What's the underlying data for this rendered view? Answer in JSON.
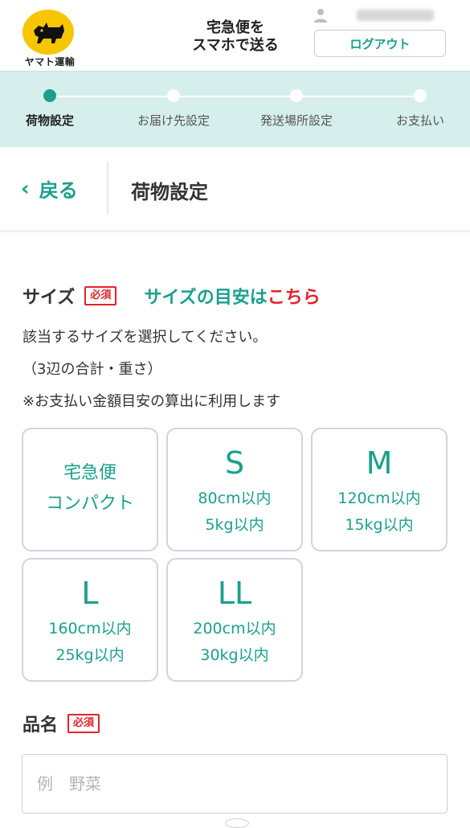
{
  "header": {
    "logo_text": "ヤマト運輸",
    "tagline_line1": "宅急便を",
    "tagline_line2": "スマホで送る",
    "logout_label": "ログアウト"
  },
  "steps": [
    {
      "label": "荷物設定",
      "active": true
    },
    {
      "label": "お届け先設定",
      "active": false
    },
    {
      "label": "発送場所設定",
      "active": false
    },
    {
      "label": "お支払い",
      "active": false
    }
  ],
  "titlebar": {
    "back_label": "戻る",
    "page_title": "荷物設定"
  },
  "size_section": {
    "label": "サイズ",
    "required_badge": "必須",
    "guide_text": "サイズの目安は",
    "guide_link": "こちら",
    "desc_line1": "該当するサイズを選択してください。",
    "desc_line2": "（3辺の合計・重さ）",
    "desc_line3": "※お支払い金額目安の算出に利用します",
    "options": [
      {
        "name_line1": "宅急便",
        "name_line2": "コンパクト"
      },
      {
        "size": "S",
        "dimension": "80cm以内",
        "weight": "5kg以内"
      },
      {
        "size": "M",
        "dimension": "120cm以内",
        "weight": "15kg以内"
      },
      {
        "size": "L",
        "dimension": "160cm以内",
        "weight": "25kg以内"
      },
      {
        "size": "LL",
        "dimension": "200cm以内",
        "weight": "30kg以内"
      }
    ]
  },
  "item_section": {
    "label": "品名",
    "required_badge": "必須",
    "placeholder": "例　野菜"
  },
  "colors": {
    "accent": "#1aa08c",
    "required": "#e2242a",
    "steps_bg": "#d6efec",
    "logo_yellow": "#F7C600"
  }
}
